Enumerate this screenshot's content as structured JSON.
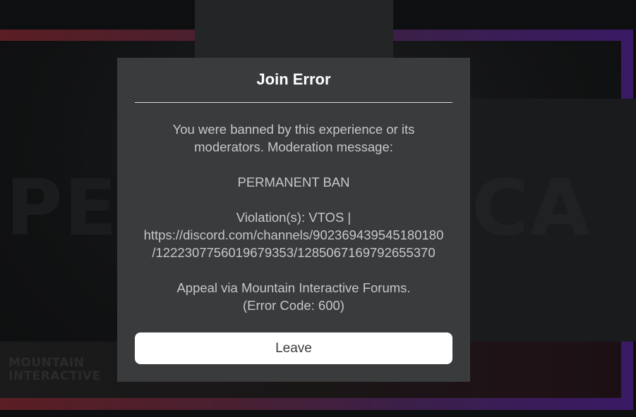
{
  "background": {
    "title_text_left": "PE",
    "title_text_right": "CA",
    "logo_line1": "MOUNTAIN",
    "logo_line2": "INTERACTIVE"
  },
  "modal": {
    "title": "Join Error",
    "message_line1": "You were banned by this experience or its",
    "message_line2": "moderators. Moderation message:",
    "ban_type": "PERMANENT BAN",
    "violation_line1": "Violation(s): VTOS |",
    "violation_line2": "https://discord.com/channels/902369439545180180",
    "violation_line3": "/1222307756019679353/1285067169792655370",
    "appeal_line": "Appeal via Mountain Interactive Forums.",
    "error_code_line": "(Error Code: 600)",
    "leave_label": "Leave"
  }
}
